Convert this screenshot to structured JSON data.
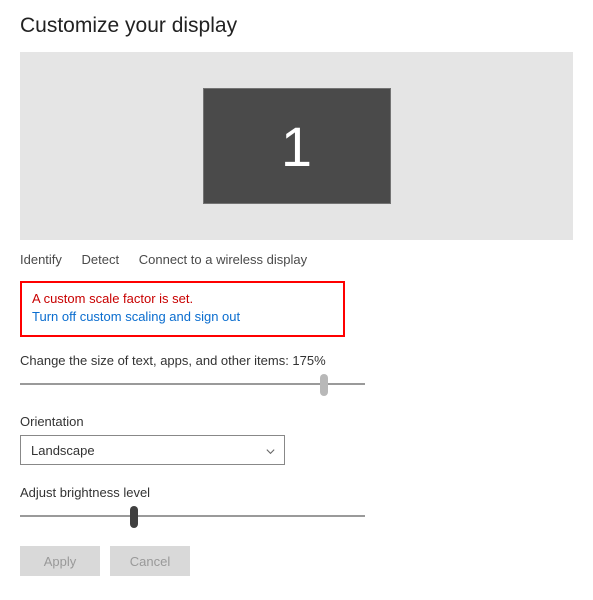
{
  "title": "Customize your display",
  "monitor_number": "1",
  "links": {
    "identify": "Identify",
    "detect": "Detect",
    "wireless": "Connect to a wireless display"
  },
  "scale_warning": {
    "message": "A custom scale factor is set.",
    "action": "Turn off custom scaling and sign out"
  },
  "scale_label": "Change the size of text, apps, and other items: 175%",
  "scale_slider_percent": 88,
  "orientation": {
    "label": "Orientation",
    "value": "Landscape"
  },
  "brightness": {
    "label": "Adjust brightness level",
    "slider_percent": 33
  },
  "buttons": {
    "apply": "Apply",
    "cancel": "Cancel"
  }
}
